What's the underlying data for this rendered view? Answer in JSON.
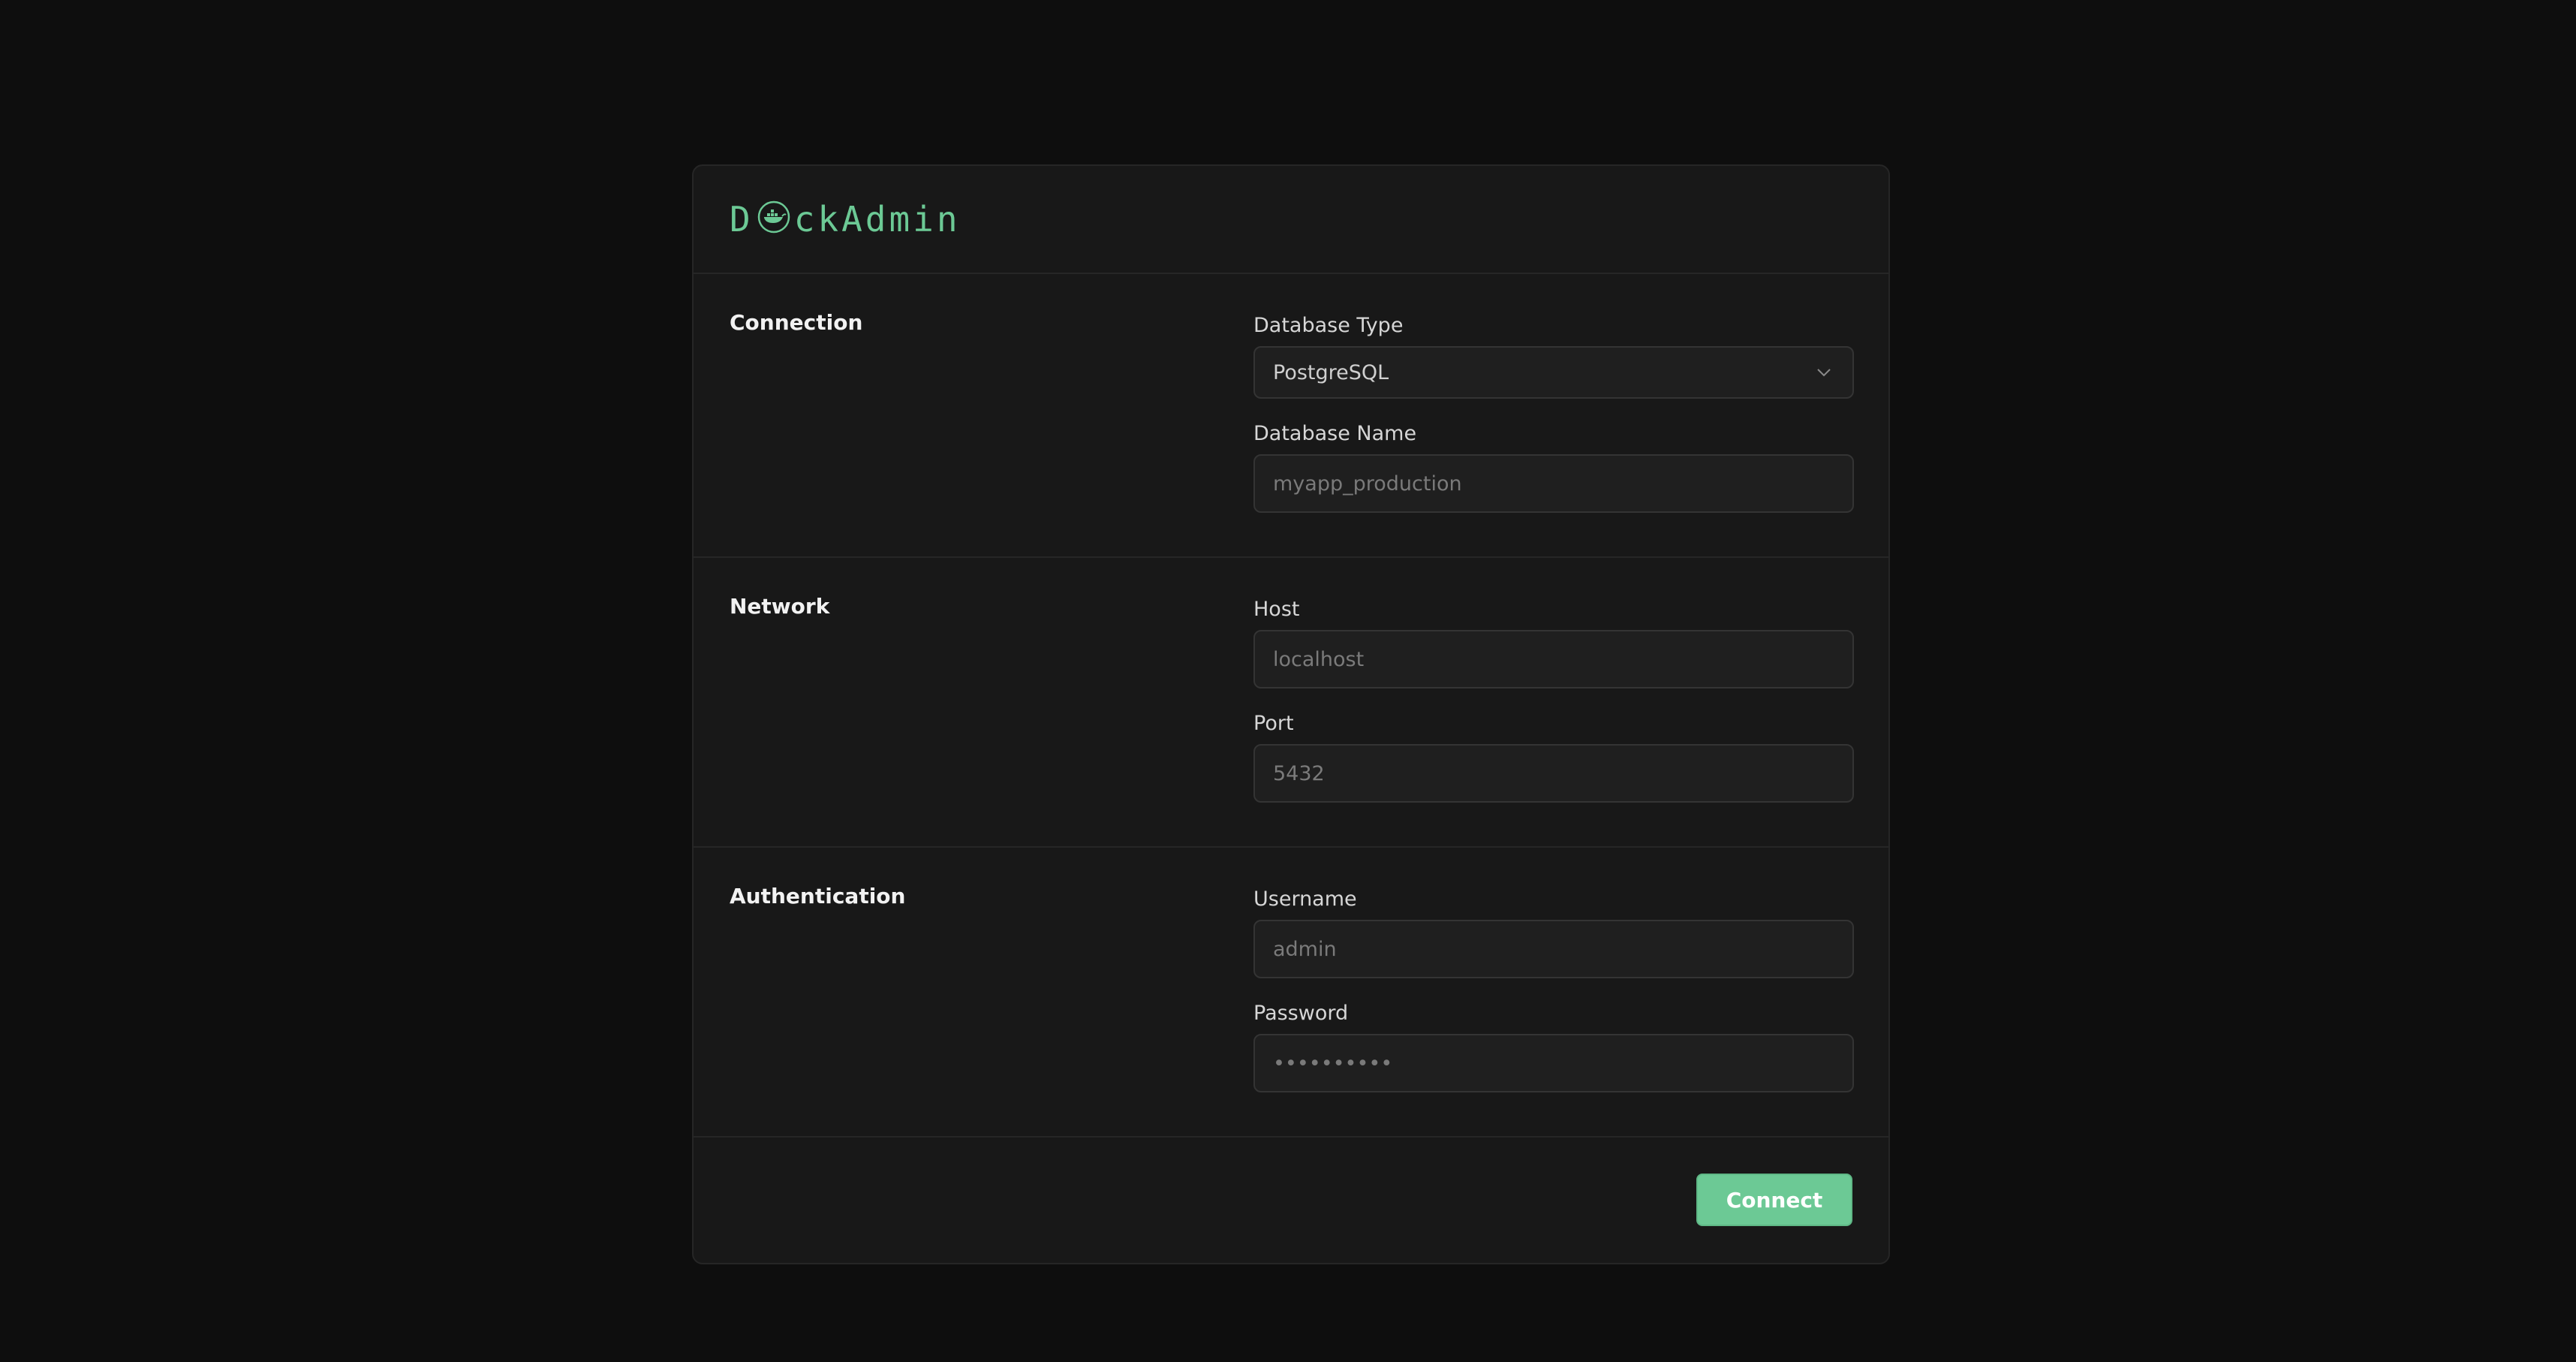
{
  "brand": {
    "name_prefix": "D",
    "name_suffix": "ckAdmin",
    "accent_color": "#6cc995"
  },
  "sections": {
    "connection": {
      "title": "Connection",
      "database_type": {
        "label": "Database Type",
        "value": "PostgreSQL",
        "icon": "chevron-down-icon"
      },
      "database_name": {
        "label": "Database Name",
        "placeholder": "myapp_production"
      }
    },
    "network": {
      "title": "Network",
      "host": {
        "label": "Host",
        "placeholder": "localhost"
      },
      "port": {
        "label": "Port",
        "placeholder": "5432"
      }
    },
    "authentication": {
      "title": "Authentication",
      "username": {
        "label": "Username",
        "placeholder": "admin"
      },
      "password": {
        "label": "Password",
        "placeholder": "••••••••••"
      }
    }
  },
  "footer": {
    "connect_label": "Connect"
  }
}
